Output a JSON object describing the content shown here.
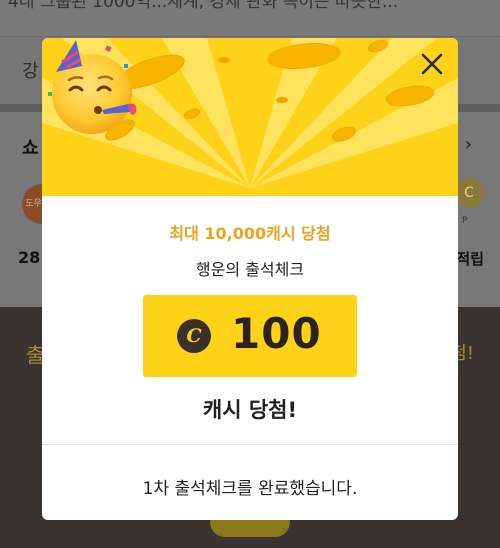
{
  "background": {
    "headline": "4대 그룹된 1000억...새계, 경제 관화 녹이는 따뜻한...",
    "row2_text": "강",
    "section_title": "쇼",
    "chevron": "›",
    "left_thumb_text": "도우미 T",
    "right_coin_text": "C",
    "right_coin_sub": "P",
    "left_label": "28",
    "right_label": "적립",
    "bottom_left": "출",
    "bottom_right": "첨!"
  },
  "modal": {
    "close_icon": "close-icon",
    "emoji_icon": "partying-face-icon",
    "hint": "최대 10,000캐시 당첨",
    "subtitle": "행운의 출석체크",
    "coin_symbol": "C",
    "amount": "100",
    "result": "캐시 당첨!",
    "footer": "1차 출석체크를 완료했습니다."
  },
  "colors": {
    "accent_yellow": "#ffd21a",
    "hint_orange": "#f2a21b",
    "coin_dark": "#3a2f2a"
  }
}
